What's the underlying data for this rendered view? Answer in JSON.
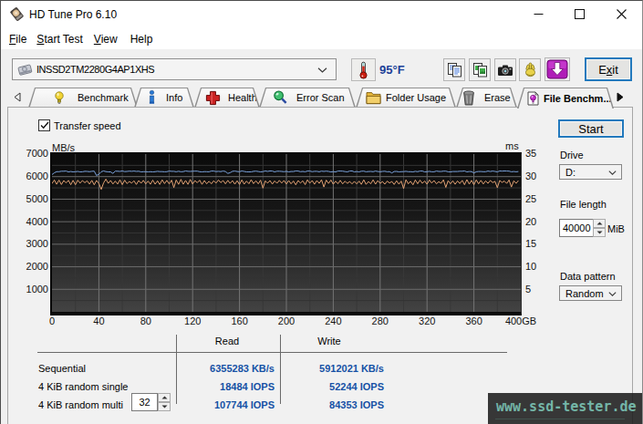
{
  "window": {
    "title": "HD Tune Pro 6.10",
    "minimize": "minimize",
    "maximize": "maximize",
    "close": "close"
  },
  "menu": {
    "items": [
      {
        "pre": "",
        "key": "F",
        "post": "ile",
        "label": "File"
      },
      {
        "pre": "",
        "key": "S",
        "post": "tart Test",
        "label": "Start Test"
      },
      {
        "pre": "",
        "key": "V",
        "post": "iew",
        "label": "View"
      },
      {
        "pre": "Help",
        "key": "",
        "post": "",
        "label": "Help"
      }
    ]
  },
  "toolbar": {
    "device": "INSSD2TM2280G4AP1XHS",
    "temperature": "95°F",
    "buttons": [
      "copy-text",
      "copy-image",
      "screenshot",
      "donate-hand",
      "save-download"
    ],
    "exit": {
      "pre": "E",
      "key": "x",
      "post": "it",
      "label": "Exit"
    }
  },
  "tabs": {
    "scroll_left": "◁",
    "scroll_right": "▶",
    "items": [
      {
        "label": "Benchmark",
        "icon": "lightbulb-yellow",
        "active": false
      },
      {
        "label": "Info",
        "icon": "info-blue",
        "active": false
      },
      {
        "label": "Health",
        "icon": "cross-red",
        "active": false
      },
      {
        "label": "Error Scan",
        "icon": "magnifier-green",
        "active": false
      },
      {
        "label": "Folder Usage",
        "icon": "folder-yellow",
        "active": false
      },
      {
        "label": "Erase",
        "icon": "trash-gray",
        "active": false
      },
      {
        "label": "File Benchm...",
        "icon": "page-bulb-magenta",
        "active": true
      }
    ],
    "active_tab": "File Benchm..."
  },
  "benchmark_panel": {
    "transfer_speed_label": "Transfer speed",
    "transfer_speed_checked": true
  },
  "chart_data": {
    "type": "line",
    "xlim": [
      0,
      400
    ],
    "x_unit": "GB",
    "xticks": [
      0,
      40,
      80,
      120,
      160,
      200,
      240,
      280,
      320,
      360
    ],
    "xtick_last_label": "400GB",
    "ylim_left": [
      0,
      7000
    ],
    "ylabel_left": "MB/s",
    "yticks_left": [
      1000,
      2000,
      3000,
      4000,
      5000,
      6000,
      7000
    ],
    "ylim_right": [
      0,
      35
    ],
    "ylabel_right": "ms",
    "yticks_right": [
      5,
      10,
      15,
      20,
      25,
      30,
      35
    ],
    "grid": {
      "minor_x_gb": 20,
      "major_x_gb": 40,
      "minor_y": 500,
      "major_y": 1000
    },
    "series": [
      {
        "name": "read",
        "color": "#7ba3dd",
        "x_start": 0,
        "x_step": 2,
        "values": [
          6090,
          6170,
          6220,
          6218,
          6240,
          6238,
          6247,
          6212,
          6227,
          6209,
          6218,
          6230,
          6209,
          6217,
          6237,
          6232,
          6218,
          6234,
          6244,
          6049,
          6105,
          6215,
          6250,
          6223,
          6212,
          6212,
          6143,
          6244,
          6240,
          6232,
          6251,
          6225,
          6232,
          6244,
          6235,
          6246,
          6233,
          6239,
          6210,
          6218,
          6221,
          6212,
          6218,
          6212,
          6220,
          6236,
          6224,
          6224,
          6217,
          6220,
          6249,
          6237,
          6235,
          6216,
          6240,
          6215,
          6225,
          6252,
          6236,
          6233,
          6238,
          6245,
          6242,
          6218,
          6209,
          6222,
          6220,
          6217,
          6249,
          6247,
          6222,
          6237,
          6225,
          6248,
          6228,
          6142,
          6173,
          6234,
          6248,
          6226,
          6218,
          6252,
          6230,
          6212,
          6210,
          6213,
          6236,
          6243,
          6227,
          6211,
          6225,
          6252,
          6231,
          6251,
          6246,
          6209,
          6240,
          6238,
          6232,
          6220,
          6236,
          6213,
          6227,
          6228,
          6250,
          6247,
          6220,
          6230,
          6216,
          6248,
          6246,
          6221,
          6236,
          6235,
          6215,
          6242,
          6232,
          6242,
          6231,
          6208,
          6222,
          6209,
          6249,
          6247,
          6245,
          6222,
          6211,
          6247,
          6250,
          6212,
          6229,
          6211,
          6241,
          6242,
          6214,
          6229,
          6232,
          6220,
          6246,
          6227,
          6217,
          6232,
          6240,
          6217,
          6222,
          6164,
          6227,
          6231,
          6213,
          6218,
          6223,
          6234,
          6218,
          6218,
          6211,
          6236,
          6218,
          6248,
          6246,
          6211,
          6218,
          6237,
          6217,
          6214,
          6249,
          6233,
          6229,
          6243,
          6244,
          6216,
          6212,
          6227,
          6227,
          6229,
          6240,
          6238,
          6251,
          6212,
          6226,
          6223,
          6162,
          6216,
          6228,
          6227,
          6220,
          6219,
          6249,
          6227,
          6246,
          6232,
          6210,
          6252,
          6245,
          6251,
          6249,
          6245,
          6215,
          6229,
          6217,
          6226
        ]
      },
      {
        "name": "write",
        "color": "#e2a274",
        "x_start": 0,
        "x_step": 2,
        "values": [
          5690,
          5852,
          5659,
          5845,
          5648,
          5827,
          5721,
          5836,
          5642,
          5834,
          5639,
          5841,
          5711,
          5827,
          5731,
          5813,
          5670,
          5835,
          5635,
          5831,
          5699,
          5435,
          5712,
          5890,
          5700,
          5832,
          5673,
          5801,
          5668,
          5860,
          5646,
          5841,
          5692,
          5781,
          5715,
          5816,
          5651,
          5826,
          5704,
          5833,
          5677,
          5804,
          5660,
          5848,
          5663,
          5815,
          5654,
          5857,
          5690,
          5833,
          5678,
          5843,
          5516,
          5852,
          5656,
          5878,
          5662,
          5832,
          5656,
          5875,
          5671,
          5824,
          5731,
          5841,
          5657,
          5828,
          5679,
          5796,
          5679,
          5818,
          5714,
          5852,
          5735,
          5827,
          5681,
          5834,
          5702,
          5823,
          5664,
          5818,
          5653,
          5856,
          5663,
          5803,
          5686,
          5865,
          5688,
          5816,
          5679,
          5844,
          5490,
          5815,
          5709,
          5826,
          5669,
          5809,
          5705,
          5833,
          5714,
          5829,
          5671,
          5827,
          5681,
          5807,
          5635,
          5828,
          5715,
          5814,
          5646,
          5860,
          5708,
          5826,
          5659,
          5826,
          5701,
          5864,
          5541,
          5847,
          5699,
          5851,
          5663,
          5797,
          5685,
          5835,
          5678,
          5800,
          5698,
          5787,
          5678,
          5790,
          5675,
          5802,
          5656,
          5860,
          5657,
          5783,
          5681,
          5857,
          5666,
          5821,
          5700,
          5784,
          5664,
          5801,
          5717,
          5787,
          5654,
          5820,
          5663,
          5804,
          5470,
          5863,
          5680,
          5793,
          5638,
          5853,
          5684,
          5846,
          5701,
          5808,
          5664,
          5856,
          5713,
          5827,
          5682,
          5774,
          5705,
          5857,
          5523,
          5817,
          5680,
          5816,
          5660,
          5812,
          5693,
          5833,
          5639,
          5869,
          5668,
          5834,
          5636,
          5853,
          5681,
          5833,
          5673,
          5816,
          5700,
          5830,
          5735,
          5789,
          5510,
          5831,
          5742,
          5807,
          5696,
          5849,
          5539,
          5816,
          5701,
          5827
        ]
      }
    ]
  },
  "controls": {
    "start_label": "Start",
    "drive_label": "Drive",
    "drive_value": "D:",
    "file_length_label": "File length",
    "file_length_value": "40000",
    "file_length_unit": "MiB",
    "data_pattern_label": "Data pattern",
    "data_pattern_value": "Random"
  },
  "results": {
    "columns": {
      "read": "Read",
      "write": "Write"
    },
    "rows": [
      {
        "label": "Sequential",
        "read": "6355283 KB/s",
        "write": "5912021 KB/s"
      },
      {
        "label": "4 KiB random single",
        "read": "18484 IOPS",
        "write": "52244 IOPS"
      },
      {
        "label": "4 KiB random multi",
        "read": "107744 IOPS",
        "write": "84353 IOPS"
      }
    ],
    "multi_thread_count": "32"
  },
  "watermark": {
    "text": "www.ssd-tester.de",
    "color": "#74b6a8"
  },
  "colors": {
    "value_blue": "#1651a5",
    "temp_blue": "#1b3f97",
    "focus_border": "#2279bd",
    "chart_bg_top": "#0c0c0c",
    "chart_bg_bottom": "#424242"
  }
}
